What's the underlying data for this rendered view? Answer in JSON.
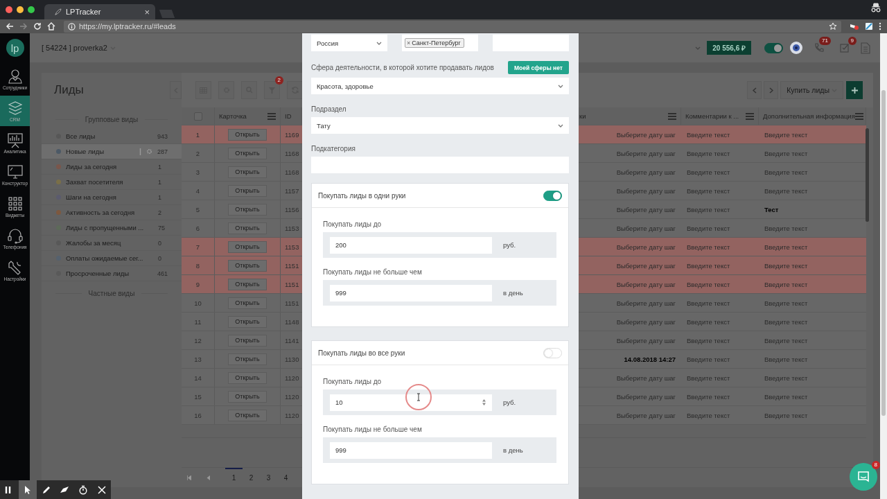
{
  "browser": {
    "tab_title": "LPTracker",
    "tab_close": "×",
    "url": "https://my.lptracker.ru/#leads"
  },
  "nav": {
    "logo": "lp",
    "items": [
      {
        "kind": "staff",
        "label": "Сотрудники",
        "selected": false
      },
      {
        "kind": "crm",
        "label": "CRM",
        "selected": true
      },
      {
        "kind": "analytics",
        "label": "Аналитика",
        "selected": false
      },
      {
        "kind": "builder",
        "label": "Конструктор",
        "selected": false
      },
      {
        "kind": "widgets",
        "label": "Виджеты",
        "selected": false
      },
      {
        "kind": "phone",
        "label": "Телефония",
        "selected": false
      },
      {
        "kind": "settings",
        "label": "Настройки",
        "selected": false
      }
    ]
  },
  "header": {
    "account": "[ 54224 ] proverka2",
    "balance": "20 556,6 ₽",
    "online": true,
    "calls_badge": "71",
    "tasks_badge": "9"
  },
  "leads": {
    "title": "Лиды",
    "filter_badge": "2",
    "buy_button": "Купить лиды",
    "group_heading": "Групповые виды",
    "private_heading": "Частные виды",
    "views": [
      {
        "label": "Все лиды",
        "count": "943",
        "color": "#575757",
        "selected": false
      },
      {
        "label": "Новые лиды",
        "count": "287",
        "color": "#4c5966",
        "selected": true
      },
      {
        "label": "Лиды за сегодня",
        "count": "1",
        "color": "#7a564b",
        "selected": false
      },
      {
        "label": "Захват посетителя",
        "count": "1",
        "color": "#7a6f48",
        "selected": false
      },
      {
        "label": "Шаги на сегодня",
        "count": "1",
        "color": "#5b5b6e",
        "selected": false
      },
      {
        "label": "Активность за сегодня",
        "count": "2",
        "color": "#7d583f",
        "selected": false
      },
      {
        "label": "Лиды с пропущенными ...",
        "count": "75",
        "color": "#5d6a59",
        "selected": false
      },
      {
        "label": "Жалобы за месяц",
        "count": "0",
        "color": "#585858",
        "selected": false
      },
      {
        "label": "Оплаты ожидаемые сег...",
        "count": "0",
        "color": "#55616e",
        "selected": false
      },
      {
        "label": "Просроченные лиды",
        "count": "461",
        "color": "#595959",
        "selected": false
      }
    ],
    "table": {
      "select_all": false,
      "columns": [
        "Карточка",
        "ID",
        "ки",
        "Комментарии к ...",
        "Дополнительная информация"
      ],
      "rows": [
        {
          "number": "1",
          "open": "Открыть",
          "id": "1169",
          "step": {
            "placeholder": "Выберите дату шаг"
          },
          "comment": {
            "placeholder": "Введите текст"
          },
          "info": {
            "placeholder": "Введите текст"
          },
          "highlighted": true
        },
        {
          "number": "2",
          "open": "Открыть",
          "id": "1168",
          "step": {
            "placeholder": "Выберите дату шаг"
          },
          "comment": {
            "placeholder": "Введите текст"
          },
          "info": {
            "placeholder": "Введите текст"
          },
          "highlighted": false
        },
        {
          "number": "3",
          "open": "Открыть",
          "id": "1168",
          "step": {
            "placeholder": "Выберите дату шаг"
          },
          "comment": {
            "placeholder": "Введите текст"
          },
          "info": {
            "placeholder": "Введите текст"
          },
          "highlighted": false
        },
        {
          "number": "4",
          "open": "Открыть",
          "id": "1157",
          "step": {
            "placeholder": "Выберите дату шаг"
          },
          "comment": {
            "placeholder": "Введите текст"
          },
          "info": {
            "placeholder": "Введите текст"
          },
          "highlighted": false
        },
        {
          "number": "5",
          "open": "Открыть",
          "id": "1156",
          "step": {
            "placeholder": "Выберите дату шаг"
          },
          "comment": {
            "placeholder": "Введите текст"
          },
          "info": {
            "value": "Тест"
          },
          "highlighted": false
        },
        {
          "number": "6",
          "open": "Открыть",
          "id": "1153",
          "step": {
            "placeholder": "Выберите дату шаг"
          },
          "comment": {
            "placeholder": "Введите текст"
          },
          "info": {
            "placeholder": "Введите текст"
          },
          "highlighted": false
        },
        {
          "number": "7",
          "open": "Открыть",
          "id": "1153",
          "step": {
            "placeholder": "Выберите дату шаг"
          },
          "comment": {
            "placeholder": "Введите текст"
          },
          "info": {
            "placeholder": "Введите текст"
          },
          "highlighted": true
        },
        {
          "number": "8",
          "open": "Открыть",
          "id": "1151",
          "step": {
            "placeholder": "Выберите дату шаг"
          },
          "comment": {
            "placeholder": "Введите текст"
          },
          "info": {
            "placeholder": "Введите текст"
          },
          "highlighted": true
        },
        {
          "number": "9",
          "open": "Открыть",
          "id": "1151",
          "step": {
            "placeholder": "Выберите дату шаг"
          },
          "comment": {
            "placeholder": "Введите текст"
          },
          "info": {
            "placeholder": "Введите текст"
          },
          "highlighted": true
        },
        {
          "number": "10",
          "open": "Открыть",
          "id": "1151",
          "step": {
            "placeholder": "Выберите дату шаг"
          },
          "comment": {
            "placeholder": "Введите текст"
          },
          "info": {
            "placeholder": "Введите текст"
          },
          "highlighted": false
        },
        {
          "number": "11",
          "open": "Открыть",
          "id": "1148",
          "step": {
            "placeholder": "Выберите дату шаг"
          },
          "comment": {
            "placeholder": "Введите текст"
          },
          "info": {
            "placeholder": "Введите текст"
          },
          "highlighted": false
        },
        {
          "number": "12",
          "open": "Открыть",
          "id": "1141",
          "step": {
            "placeholder": "Выберите дату шаг"
          },
          "comment": {
            "placeholder": "Введите текст"
          },
          "info": {
            "placeholder": "Введите текст"
          },
          "highlighted": false
        },
        {
          "number": "13",
          "open": "Открыть",
          "id": "1130",
          "step": {
            "value": "14.08.2018 14:27"
          },
          "comment": {
            "placeholder": "Введите текст"
          },
          "info": {
            "placeholder": "Введите текст"
          },
          "highlighted": false
        },
        {
          "number": "14",
          "open": "Открыть",
          "id": "1120",
          "step": {
            "placeholder": "Выберите дату шаг"
          },
          "comment": {
            "placeholder": "Введите текст"
          },
          "info": {
            "placeholder": "Введите текст"
          },
          "highlighted": false
        },
        {
          "number": "15",
          "open": "Открыть",
          "id": "1120",
          "step": {
            "placeholder": "Выберите дату шаг"
          },
          "comment": {
            "placeholder": "Введите текст"
          },
          "info": {
            "placeholder": "Введите текст"
          },
          "highlighted": false
        },
        {
          "number": "16",
          "open": "Открыть",
          "id": "1120",
          "step": {
            "placeholder": "Выберите дату шаг"
          },
          "comment": {
            "placeholder": "Введите текст"
          },
          "info": {
            "placeholder": "Введите текст"
          },
          "highlighted": false
        }
      ]
    },
    "pagination": [
      {
        "label": "1",
        "selected": true
      },
      {
        "label": "2",
        "selected": false
      },
      {
        "label": "3",
        "selected": false
      },
      {
        "label": "4",
        "selected": false
      }
    ]
  },
  "modal": {
    "location_fields": [
      {
        "kind": "select",
        "value": "Россия"
      },
      {
        "kind": "tags",
        "tags": [
          {
            "label": "Санкт-Петербург",
            "remove": "×"
          }
        ]
      },
      {
        "kind": "text"
      }
    ],
    "sphere": {
      "label": "Сфера деятельности, в которой хотите продавать лидов",
      "button": "Моей сферы нет",
      "value": "Красота, здоровье"
    },
    "subsection": {
      "label": "Подраздел",
      "value": "Тату"
    },
    "subcategory": {
      "label": "Подкатегория"
    },
    "sections": [
      {
        "title": "Покупать лиды в одни руки",
        "on": true,
        "limits": [
          {
            "label": "Покупать лиды до",
            "value": "200",
            "unit": "руб.",
            "kind": "text"
          },
          {
            "label": "Покупать лиды не больше чем",
            "value": "999",
            "unit": "в день",
            "kind": "text"
          }
        ]
      },
      {
        "title": "Покупать лиды во все руки",
        "on": false,
        "limits": [
          {
            "label": "Покупать лиды до",
            "value": "10",
            "unit": "руб.",
            "kind": "spinner"
          },
          {
            "label": "Покупать лиды не больше чем",
            "value": "999",
            "unit": "в день",
            "kind": "text"
          }
        ]
      }
    ]
  },
  "recorder": [
    {
      "kind": "pause",
      "selected": false
    },
    {
      "kind": "pointer",
      "selected": true
    },
    {
      "kind": "pen",
      "selected": false
    },
    {
      "kind": "eraser",
      "selected": false
    },
    {
      "kind": "timer",
      "selected": false
    },
    {
      "kind": "close",
      "selected": false
    }
  ],
  "chat": {
    "badge": "8"
  }
}
